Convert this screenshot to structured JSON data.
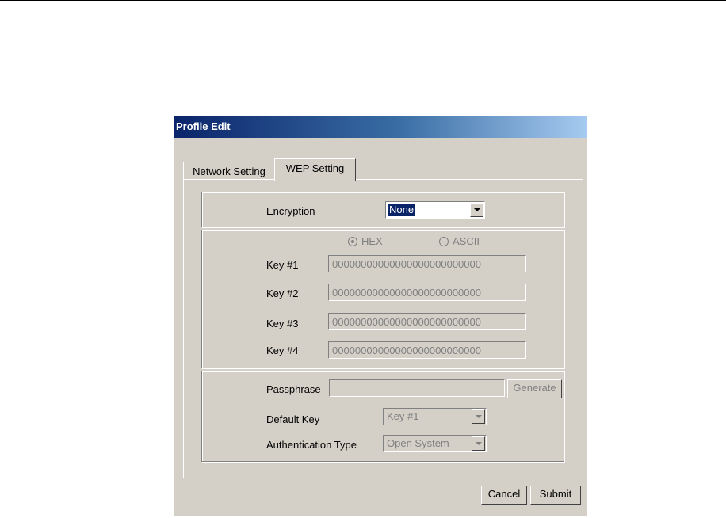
{
  "window": {
    "title": "Profile Edit"
  },
  "tabs": [
    {
      "label": "Network Setting",
      "active": false
    },
    {
      "label": "WEP Setting",
      "active": true
    }
  ],
  "encryption": {
    "label": "Encryption",
    "value": "None"
  },
  "key_format": {
    "hex_label": "HEX",
    "ascii_label": "ASCII",
    "selected": "HEX"
  },
  "keys": [
    {
      "label": "Key #1",
      "value": "00000000000000000000000000"
    },
    {
      "label": "Key #2",
      "value": "00000000000000000000000000"
    },
    {
      "label": "Key #3",
      "value": "00000000000000000000000000"
    },
    {
      "label": "Key #4",
      "value": "00000000000000000000000000"
    }
  ],
  "passphrase": {
    "label": "Passphrase",
    "value": "",
    "generate_label": "Generate"
  },
  "default_key": {
    "label": "Default Key",
    "value": "Key #1"
  },
  "auth_type": {
    "label": "Authentication Type",
    "value": "Open System"
  },
  "buttons": {
    "cancel": "Cancel",
    "submit": "Submit"
  },
  "colors": {
    "title_start": "#0a246a",
    "title_end": "#a6caf0",
    "face": "#d4d0c8",
    "highlight": "#0a246a"
  }
}
